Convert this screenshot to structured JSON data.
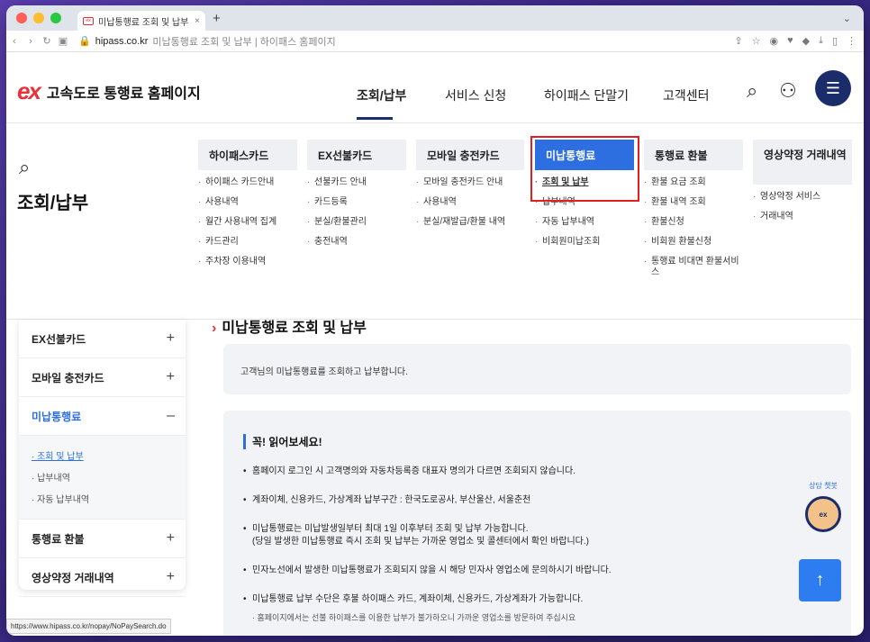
{
  "browser": {
    "tab_title": "미납통행료 조회 및 납부 | 하이패스",
    "new_tab": "+",
    "url_domain": "hipass.co.kr",
    "url_path": "미납통행료 조회 및 납부 | 하이패스 홈페이지",
    "status_url": "https://www.hipass.co.kr/nopay/NoPaySearch.do",
    "light_colors": [
      "#ff5f57",
      "#febc2e",
      "#28c840"
    ]
  },
  "header": {
    "logo_mark": "ex",
    "logo_text": "고속도로 통행료 홈페이지",
    "gnb": [
      "조회/납부",
      "서비스 신청",
      "하이패스 단말기",
      "고객센터"
    ],
    "active_index": 0
  },
  "mega": {
    "section_title": "조회/납부",
    "columns": [
      {
        "head": "하이패스카드",
        "items": [
          "하이패스 카드안내",
          "사용내역",
          "월간 사용내역 집계",
          "카드관리",
          "주차장 이용내역"
        ]
      },
      {
        "head": "EX선불카드",
        "items": [
          "선불카드 안내",
          "카드등록",
          "분실/환불관리",
          "충전내역"
        ]
      },
      {
        "head": "모바일 충전카드",
        "items": [
          "모바일 충전카드 안내",
          "사용내역",
          "분실/재발급/환불 내역"
        ]
      },
      {
        "head": "미납통행료",
        "items": [
          "조회 및 납부",
          "납부내역",
          "자동 납부내역",
          "비회원미납조회"
        ]
      },
      {
        "head": "통행료 환불",
        "items": [
          "환불 요금 조회",
          "환불 내역 조회",
          "환불신청",
          "비회원 환불신청",
          "통행료 비대면 환불서비스"
        ]
      },
      {
        "head": "영상약정 거래내역",
        "items": [
          "영상약정 서비스",
          "거래내역"
        ]
      }
    ]
  },
  "sidebar": {
    "items": [
      {
        "label": "EX선불카드",
        "sign": "+"
      },
      {
        "label": "모바일 충전카드",
        "sign": "+"
      },
      {
        "label": "미납통행료",
        "sign": "–"
      },
      {
        "label": "통행료 환불",
        "sign": "+"
      },
      {
        "label": "영상약정 거래내역",
        "sign": "+"
      }
    ],
    "sub_items": [
      "조회 및 납부",
      "납부내역",
      "자동 납부내역"
    ]
  },
  "main": {
    "page_title": "미납통행료 조회 및 납부",
    "description": "고객님의 미납통행료를 조회하고 납부합니다.",
    "notice_title": "꼭! 읽어보세요!",
    "notices": [
      {
        "text": "홈페이지 로그인 시 고객명의와 자동차등록증 대표자 명의가 다르면 조회되지 않습니다."
      },
      {
        "text": "계좌이체, 신용카드, 가상계좌 납부구간 : 한국도로공사, 부산울산, 서울춘천"
      },
      {
        "text": "미납통행료는 미납발생일부터 최대 1일 이후부터 조회 및 납부 가능합니다.",
        "text2": "(당일 발생한 미납통행료 즉시 조회 및 납부는 가까운 영업소 및 콜센터에서 확인 바랍니다.)"
      },
      {
        "text": "민자노선에서 발생한 미납통행료가 조회되지 않을 시 해당 민자사 영업소에 문의하시기 바랍니다."
      },
      {
        "text": "미납통행료 납부 수단은 후불 하이패스 카드, 계좌이체, 신용카드, 가상계좌가 가능합니다.",
        "sub": "· 홈페이지에서는 선불 하이패스를 이용한 납부가 불가하오니 가까운 영업소를 방문하여 주십시요"
      }
    ]
  },
  "floating": {
    "chat_label": "상담 챗봇",
    "mascot_text": "ex",
    "top_button": "↑"
  }
}
